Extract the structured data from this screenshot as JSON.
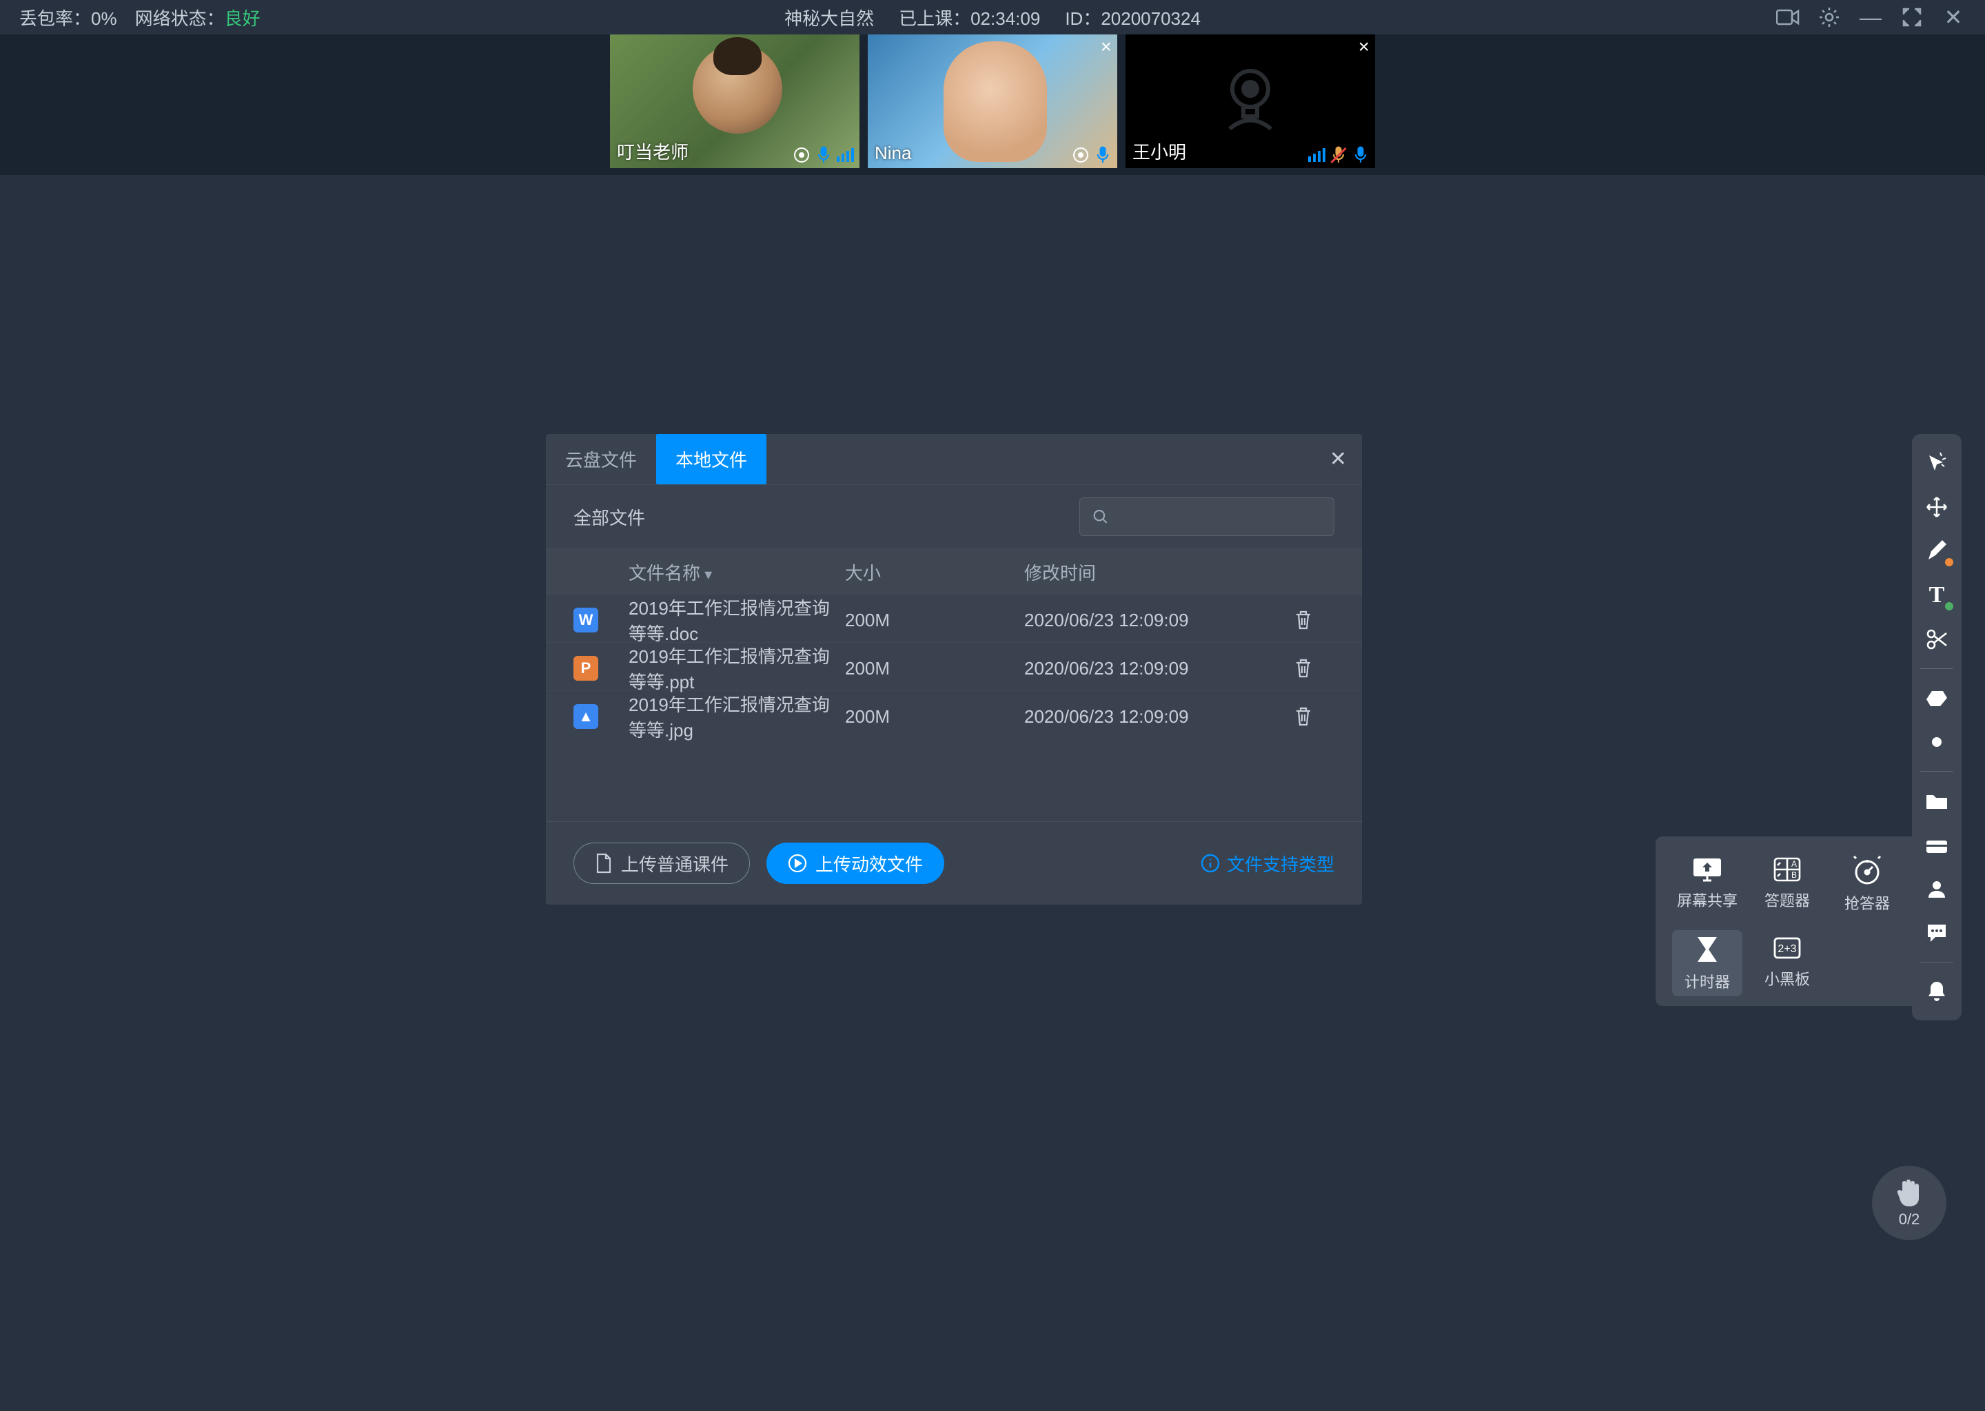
{
  "topbar": {
    "packet_loss_label": "丢包率：",
    "packet_loss_value": "0%",
    "network_label": "网络状态：",
    "network_value": "良好",
    "title": "神秘大自然",
    "elapsed_label": "已上课：",
    "elapsed_value": "02:34:09",
    "id_label": "ID：",
    "id_value": "2020070324"
  },
  "participants": [
    {
      "name": "叮当老师",
      "mic_on": true,
      "camera_off": false,
      "closeable": false
    },
    {
      "name": "Nina",
      "mic_on": true,
      "camera_off": false,
      "closeable": true
    },
    {
      "name": "王小明",
      "mic_on": true,
      "mic_muted": true,
      "camera_off": true,
      "closeable": true
    }
  ],
  "dialog": {
    "tabs": {
      "cloud": "云盘文件",
      "local": "本地文件"
    },
    "breadcrumb": "全部文件",
    "columns": {
      "name": "文件名称",
      "size": "大小",
      "mtime": "修改时间"
    },
    "files": [
      {
        "icon": "w",
        "glyph": "W",
        "name": "2019年工作汇报情况查询等等.doc",
        "size": "200M",
        "mtime": "2020/06/23 12:09:09"
      },
      {
        "icon": "p",
        "glyph": "P",
        "name": "2019年工作汇报情况查询等等.ppt",
        "size": "200M",
        "mtime": "2020/06/23 12:09:09"
      },
      {
        "icon": "img",
        "glyph": "▲",
        "name": "2019年工作汇报情况查询等等.jpg",
        "size": "200M",
        "mtime": "2020/06/23 12:09:09"
      }
    ],
    "upload_normal": "上传普通课件",
    "upload_anim": "上传动效文件",
    "supported": "文件支持类型"
  },
  "tool_popup": {
    "screen_share": "屏幕共享",
    "answer": "答题器",
    "responder": "抢答器",
    "timer": "计时器",
    "blackboard": "小黑板"
  },
  "raise": {
    "count": "0/2"
  }
}
